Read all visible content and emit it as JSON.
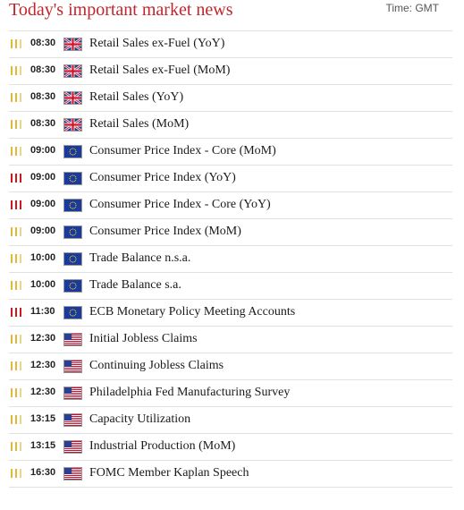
{
  "header": {
    "title": "Today's important market news",
    "timezone_label": "Time: GMT"
  },
  "colors": {
    "title": "#c0262c",
    "impact_high": "#d0171e",
    "impact_medium": "#e3b83a"
  },
  "events": [
    {
      "impact": "medium",
      "time": "08:30",
      "country": "uk-flag",
      "name": "Retail Sales ex-Fuel (YoY)"
    },
    {
      "impact": "medium",
      "time": "08:30",
      "country": "uk-flag",
      "name": "Retail Sales ex-Fuel (MoM)"
    },
    {
      "impact": "medium",
      "time": "08:30",
      "country": "uk-flag",
      "name": "Retail Sales (YoY)"
    },
    {
      "impact": "medium",
      "time": "08:30",
      "country": "uk-flag",
      "name": "Retail Sales (MoM)"
    },
    {
      "impact": "medium",
      "time": "09:00",
      "country": "eu-flag",
      "name": "Consumer Price Index - Core (MoM)"
    },
    {
      "impact": "high",
      "time": "09:00",
      "country": "eu-flag",
      "name": "Consumer Price Index (YoY)"
    },
    {
      "impact": "high",
      "time": "09:00",
      "country": "eu-flag",
      "name": "Consumer Price Index - Core (YoY)"
    },
    {
      "impact": "medium",
      "time": "09:00",
      "country": "eu-flag",
      "name": "Consumer Price Index (MoM)"
    },
    {
      "impact": "medium",
      "time": "10:00",
      "country": "eu-flag",
      "name": "Trade Balance n.s.a."
    },
    {
      "impact": "medium",
      "time": "10:00",
      "country": "eu-flag",
      "name": "Trade Balance s.a."
    },
    {
      "impact": "high",
      "time": "11:30",
      "country": "eu-flag",
      "name": "ECB Monetary Policy Meeting Accounts"
    },
    {
      "impact": "medium",
      "time": "12:30",
      "country": "us-flag",
      "name": "Initial Jobless Claims"
    },
    {
      "impact": "medium",
      "time": "12:30",
      "country": "us-flag",
      "name": "Continuing Jobless Claims"
    },
    {
      "impact": "medium",
      "time": "12:30",
      "country": "us-flag",
      "name": "Philadelphia Fed Manufacturing Survey"
    },
    {
      "impact": "medium",
      "time": "13:15",
      "country": "us-flag",
      "name": "Capacity Utilization"
    },
    {
      "impact": "medium",
      "time": "13:15",
      "country": "us-flag",
      "name": "Industrial Production (MoM)"
    },
    {
      "impact": "medium",
      "time": "16:30",
      "country": "us-flag",
      "name": "FOMC Member Kaplan Speech"
    }
  ]
}
